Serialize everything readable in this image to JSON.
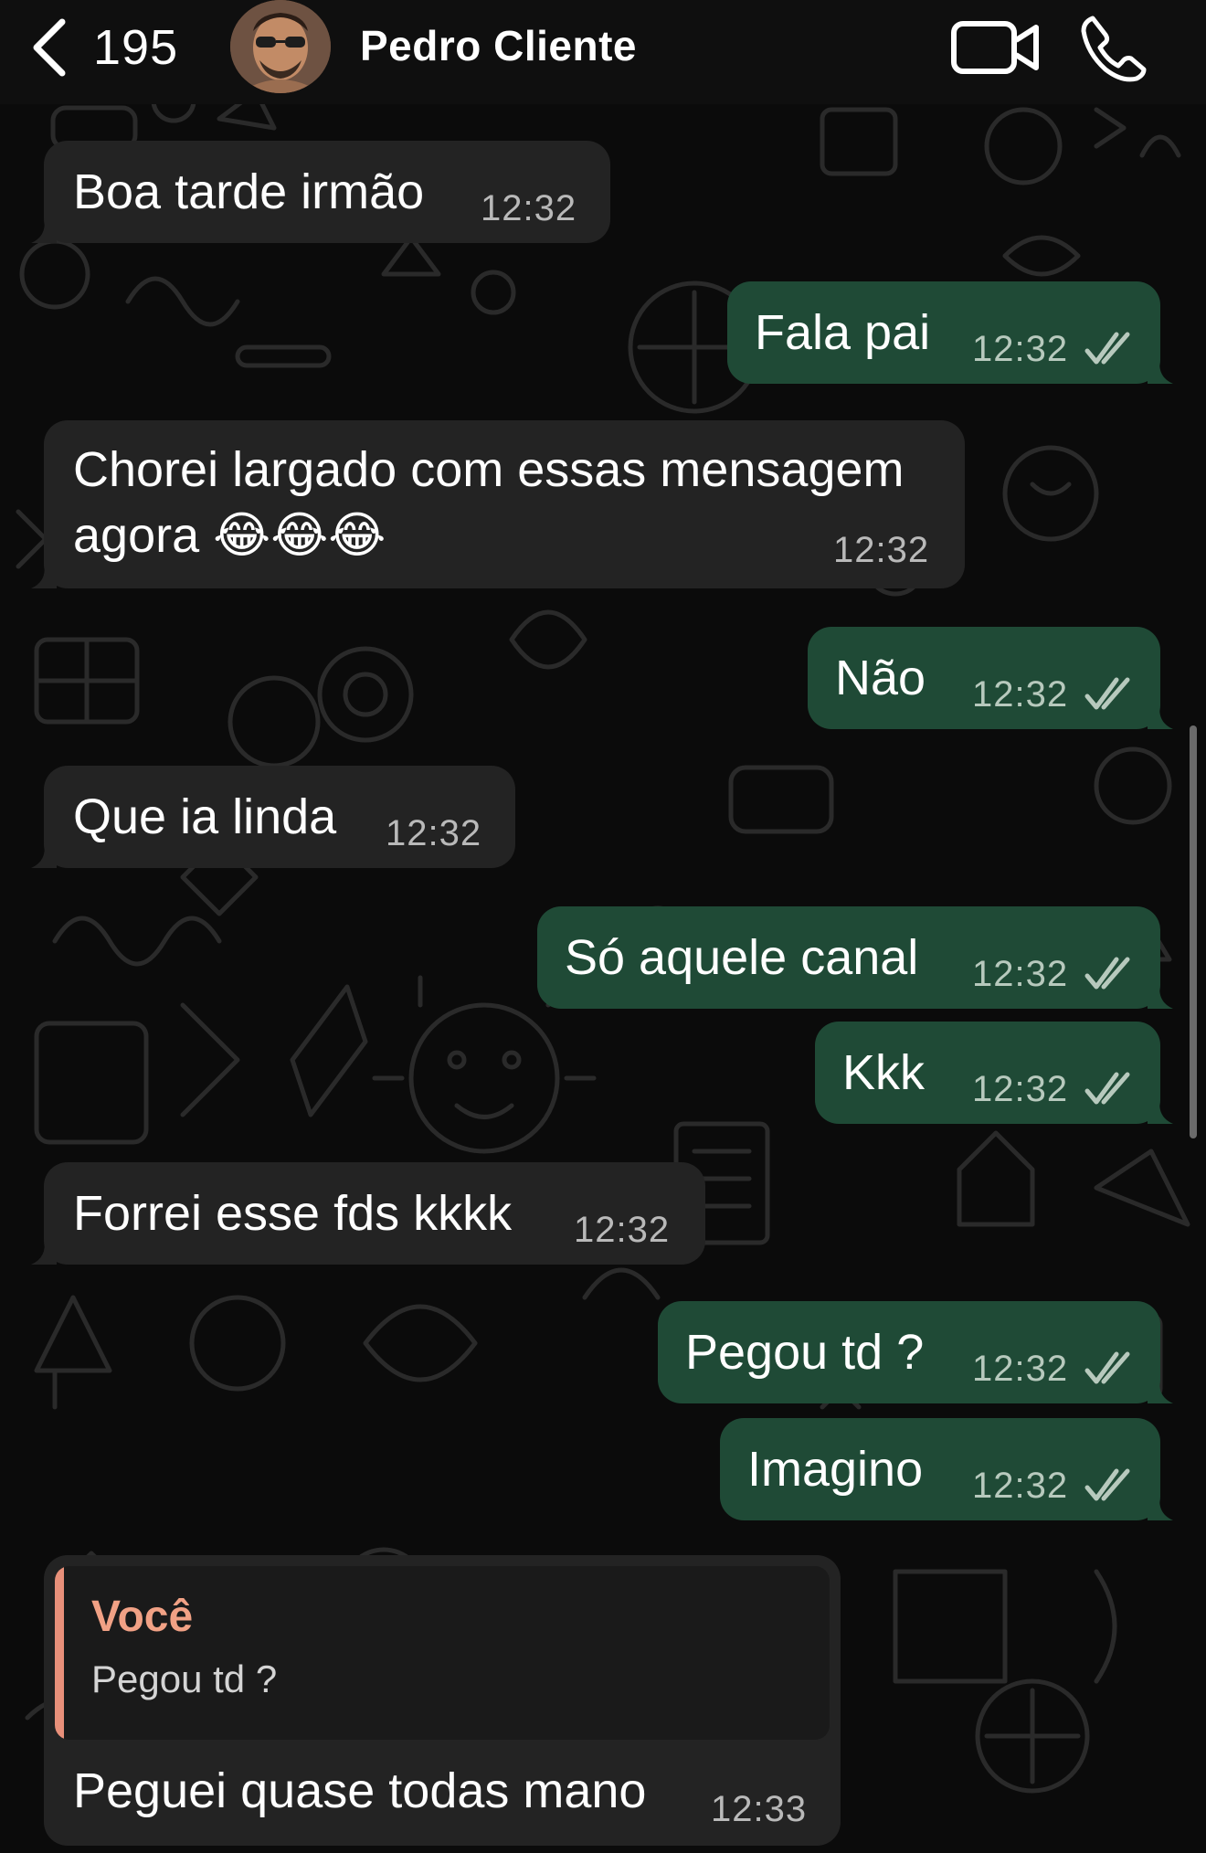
{
  "header": {
    "unread_count": "195",
    "contact_name": "Pedro Cliente"
  },
  "messages": [
    {
      "direction": "in",
      "text": "Boa tarde irmão",
      "time": "12:32"
    },
    {
      "direction": "out",
      "text": "Fala pai",
      "time": "12:32",
      "status": "read"
    },
    {
      "direction": "in",
      "text_line1": "Chorei largado com essas mensagem",
      "text_line2": "agora 😂😂😂",
      "time": "12:32"
    },
    {
      "direction": "out",
      "text": "Não",
      "time": "12:32",
      "status": "read"
    },
    {
      "direction": "in",
      "text": "Que ia linda",
      "time": "12:32"
    },
    {
      "direction": "out",
      "text": "Só aquele canal",
      "time": "12:32",
      "status": "read"
    },
    {
      "direction": "out",
      "text": "Kkk",
      "time": "12:32",
      "status": "read"
    },
    {
      "direction": "in",
      "text": "Forrei esse fds kkkk",
      "time": "12:32"
    },
    {
      "direction": "out",
      "text": "Pegou td ?",
      "time": "12:32",
      "status": "read"
    },
    {
      "direction": "out",
      "text": "Imagino",
      "time": "12:32",
      "status": "read"
    },
    {
      "direction": "in",
      "reply_author": "Você",
      "reply_text": "Pegou td ?",
      "text": "Peguei quase todas mano",
      "time": "12:33"
    }
  ],
  "icons": {
    "back": "chevron-left-icon",
    "video": "video-camera-icon",
    "call": "phone-icon",
    "read": "double-check-icon"
  },
  "colors": {
    "incoming_bubble": "#232323",
    "outgoing_bubble": "#1f4a36",
    "reply_accent": "#e8907a",
    "background": "#0b0b0b"
  }
}
